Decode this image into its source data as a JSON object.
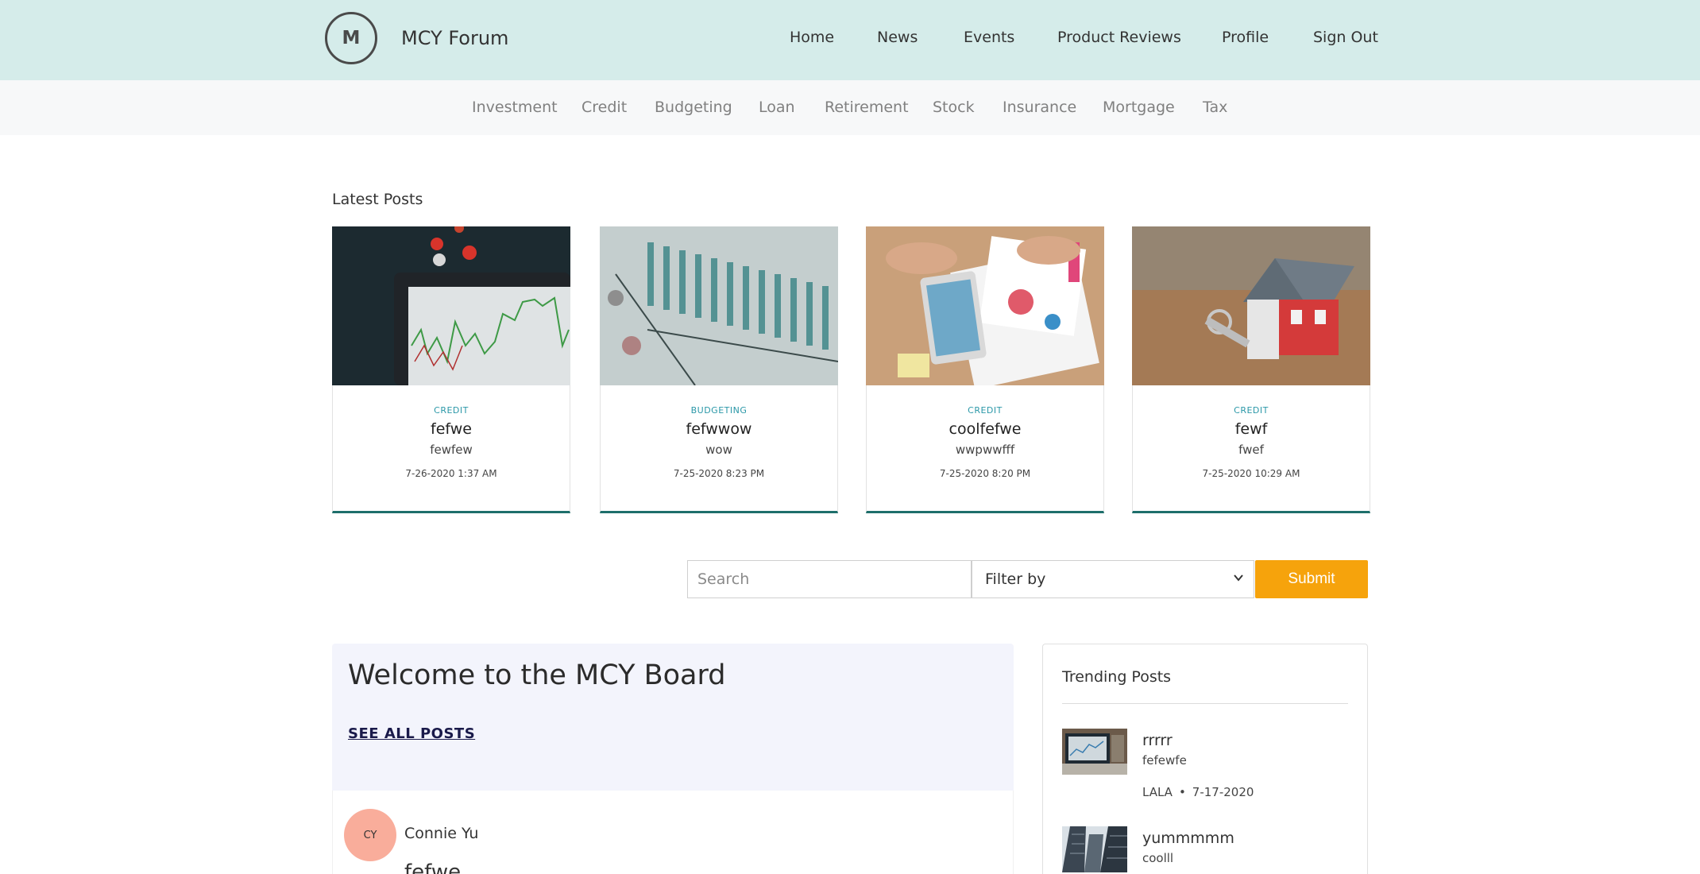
{
  "header": {
    "logo_letter": "M",
    "brand": "MCY Forum",
    "nav": [
      "Home",
      "News",
      "Events",
      "Product Reviews",
      "Profile",
      "Sign Out"
    ]
  },
  "categories": [
    "Investment",
    "Credit",
    "Budgeting",
    "Loan",
    "Retirement",
    "Stock",
    "Insurance",
    "Mortgage",
    "Tax"
  ],
  "latest": {
    "title": "Latest Posts",
    "cards": [
      {
        "category": "CREDIT",
        "title": "fefwe",
        "subtitle": "fewfew",
        "date": "7-26-2020 1:37 AM",
        "image": "stock-chart-photo"
      },
      {
        "category": "BUDGETING",
        "title": "fefwwow",
        "subtitle": "wow",
        "date": "7-25-2020 8:23 PM",
        "image": "glass-bottles-photo"
      },
      {
        "category": "CREDIT",
        "title": "coolfefwe",
        "subtitle": "wwpwwfff",
        "date": "7-25-2020 8:20 PM",
        "image": "charts-paper-photo"
      },
      {
        "category": "CREDIT",
        "title": "fewf",
        "subtitle": "fwef",
        "date": "7-25-2020 10:29 AM",
        "image": "house-keys-photo"
      }
    ]
  },
  "search": {
    "placeholder": "Search",
    "filter_label": "Filter by",
    "submit": "Submit",
    "accent": "#f6a30c"
  },
  "welcome": {
    "heading": "Welcome to the MCY Board",
    "see_all": "SEE ALL POSTS"
  },
  "post": {
    "avatar_initials": "CY",
    "author": "Connie Yu",
    "peek": "fefwe"
  },
  "trending": {
    "title": "Trending Posts",
    "items": [
      {
        "name": "rrrrr",
        "desc": "fefewfe",
        "author": "LALA",
        "date": "7-17-2020"
      },
      {
        "name": "yummmmm",
        "desc": "coolll",
        "author": "",
        "date": ""
      }
    ]
  }
}
